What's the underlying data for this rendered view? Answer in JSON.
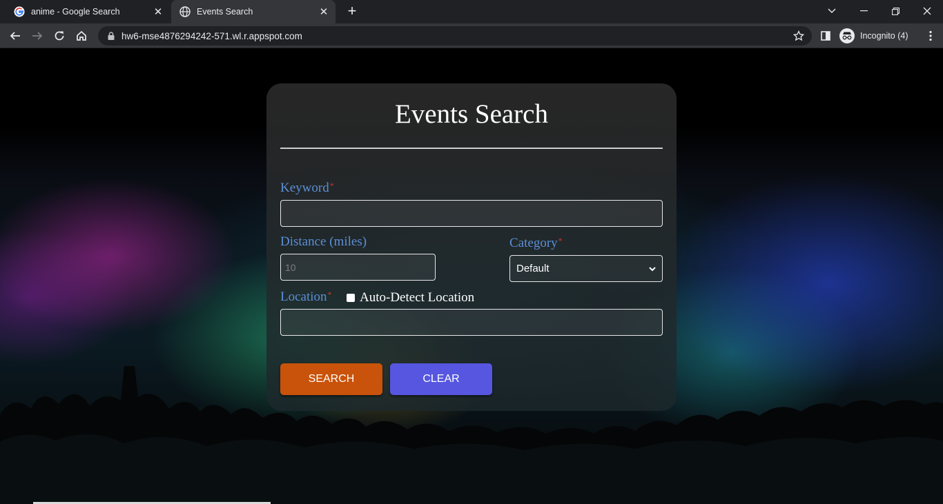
{
  "browser": {
    "tabs": [
      {
        "title": "anime - Google Search",
        "active": false
      },
      {
        "title": "Events Search",
        "active": true
      }
    ],
    "url": "hw6-mse4876294242-571.wl.r.appspot.com",
    "profile_label": "Incognito (4)"
  },
  "form": {
    "title": "Events Search",
    "keyword": {
      "label": "Keyword",
      "required_mark": "*",
      "value": ""
    },
    "distance": {
      "label": "Distance (miles)",
      "placeholder": "10",
      "value": ""
    },
    "category": {
      "label": "Category",
      "required_mark": "*",
      "selected": "Default"
    },
    "location": {
      "label": "Location",
      "required_mark": "*",
      "value": ""
    },
    "auto_detect": {
      "label": "Auto-Detect Location",
      "checked": false
    },
    "search_label": "SEARCH",
    "clear_label": "CLEAR"
  },
  "colors": {
    "label_blue": "#5b8fd6",
    "required_red": "#d9342b",
    "search_button": "#c9530a",
    "clear_button": "#5656e0"
  }
}
